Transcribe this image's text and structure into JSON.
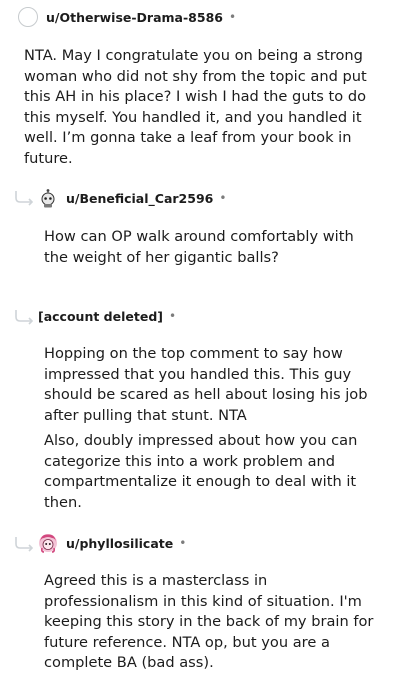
{
  "comments": [
    {
      "username": "u/Otherwise-Drama-8586",
      "separator": "•",
      "avatar": "default-snoo-outline-icon",
      "paragraphs": [
        "NTA. May I congratulate you on being a strong woman who did not shy from the topic and put this AH in his place? I wish I had the guts to do this myself. You handled it, and you handled it well. I’m gonna take a leaf from your book in future."
      ]
    },
    {
      "username": "u/Beneficial_Car2596",
      "separator": "•",
      "avatar": "snoo-avatar-icon",
      "paragraphs": [
        "How can OP walk around comfortably with the weight of her gigantic balls?"
      ]
    },
    {
      "username": "[account deleted]",
      "separator": "•",
      "avatar": "",
      "paragraphs": [
        "Hopping on the top comment to say how impressed that you handled this. This guy should be scared as hell about losing his job after pulling that stunt. NTA",
        "Also, doubly impressed about how you can categorize this into a work problem and compartmentalize it enough to deal with it then."
      ]
    },
    {
      "username": "u/phyllosilicate",
      "separator": "•",
      "avatar": "pink-hair-snoo-avatar-icon",
      "paragraphs": [
        "Agreed this is a masterclass in professionalism in this kind of situation. I'm keeping this story in the back of my brain for future reference. NTA op, but you are a complete BA (bad ass)."
      ]
    }
  ],
  "colors": {
    "text": "#1c1c1c",
    "meta": "#7c7c7c",
    "thread_line": "#cfd4d8"
  }
}
